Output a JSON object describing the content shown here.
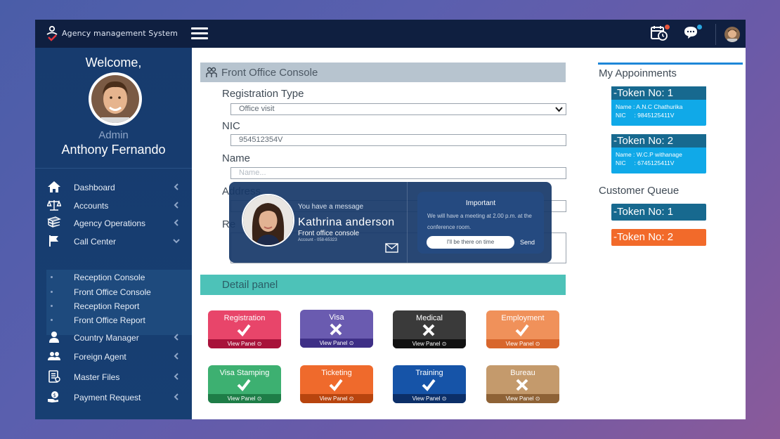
{
  "app": {
    "title": "Agency management System"
  },
  "topbar": {
    "menu_icon": "hamburger-icon",
    "icons": [
      {
        "name": "calendar-clock-icon",
        "badge_color": "#e8563c"
      },
      {
        "name": "chat-bubble-icon",
        "badge_color": "#2aa7e0"
      }
    ]
  },
  "profile": {
    "welcome": "Welcome,",
    "role": "Admin",
    "name": "Anthony Fernando"
  },
  "sidebar": {
    "items": [
      {
        "label": "Dashboard",
        "icon": "home-icon"
      },
      {
        "label": "Accounts",
        "icon": "scale-icon"
      },
      {
        "label": "Agency Operations",
        "icon": "books-icon"
      },
      {
        "label": "Call Center",
        "icon": "flag-icon",
        "expanded": true
      },
      {
        "label": "Country Manager",
        "icon": "user-icon"
      },
      {
        "label": "Foreign Agent",
        "icon": "users-icon"
      },
      {
        "label": "Master Files",
        "icon": "document-icon"
      },
      {
        "label": "Payment Request",
        "icon": "money-hand-icon"
      }
    ],
    "sub_items": [
      {
        "label": "Reception Console"
      },
      {
        "label": "Front Office Console"
      },
      {
        "label": "Reception Report"
      },
      {
        "label": "Front Office Report"
      }
    ]
  },
  "console": {
    "title": "Front Office Console",
    "registration_type_label": "Registration Type",
    "registration_type_value": "Office visit",
    "nic_label": "NIC",
    "nic_value": "954512354V",
    "name_label": "Name",
    "name_placeholder": "Name...",
    "address_label": "Address",
    "remarks_label_partial": "Re"
  },
  "detail_panel": {
    "title": "Detail panel",
    "tiles": [
      {
        "label": "Registration",
        "status": "check",
        "footer": "View Panel",
        "color": "#e8456a",
        "foot_color": "#a8123a"
      },
      {
        "label": "Visa",
        "status": "cross",
        "footer": "View Panel",
        "color": "#6a5bb0",
        "foot_color": "#3e2f86"
      },
      {
        "label": "Medical",
        "status": "cross",
        "footer": "View Panel",
        "color": "#3a3a3a",
        "foot_color": "#111111"
      },
      {
        "label": "Employment",
        "status": "check",
        "footer": "View Panel",
        "color": "#f0915a",
        "foot_color": "#d8662c"
      },
      {
        "label": "Visa Stamping",
        "status": "check",
        "footer": "View Panel",
        "color": "#3db071",
        "foot_color": "#1e7d47"
      },
      {
        "label": "Ticketing",
        "status": "check",
        "footer": "View Panel",
        "color": "#ef6a2c",
        "foot_color": "#b8440e"
      },
      {
        "label": "Training",
        "status": "check",
        "footer": "View Panel",
        "color": "#1654a8",
        "foot_color": "#0c2f68"
      },
      {
        "label": "Bureau",
        "status": "cross",
        "footer": "View Panel",
        "color": "#c49a6c",
        "foot_color": "#8e6236"
      }
    ]
  },
  "message": {
    "intro": "You have a message",
    "sender": "Kathrina  anderson",
    "sender_role": "Front office console",
    "account": "Account - 058-65323",
    "important_title": "Important",
    "important_body": "We will have a meeting at 2.00 p.m. at the conference room.",
    "reply_text": "I'll be there on time",
    "send_label": "Send"
  },
  "appointments": {
    "title": "My Appoinments",
    "cards": [
      {
        "token": "-Token No: 1",
        "name": "Name : A.N.C Chathurika",
        "nic": "NIC     : 9845125411V"
      },
      {
        "token": "-Token No: 2",
        "name": "Name : W.C.P withanage",
        "nic": "NIC     : 6745125411V"
      }
    ]
  },
  "queue": {
    "title": "Customer Queue",
    "tokens": [
      {
        "label": "-Token No: 1",
        "color": "#17698f"
      },
      {
        "label": "-Token No: 2",
        "color": "#f26a2a"
      }
    ]
  }
}
